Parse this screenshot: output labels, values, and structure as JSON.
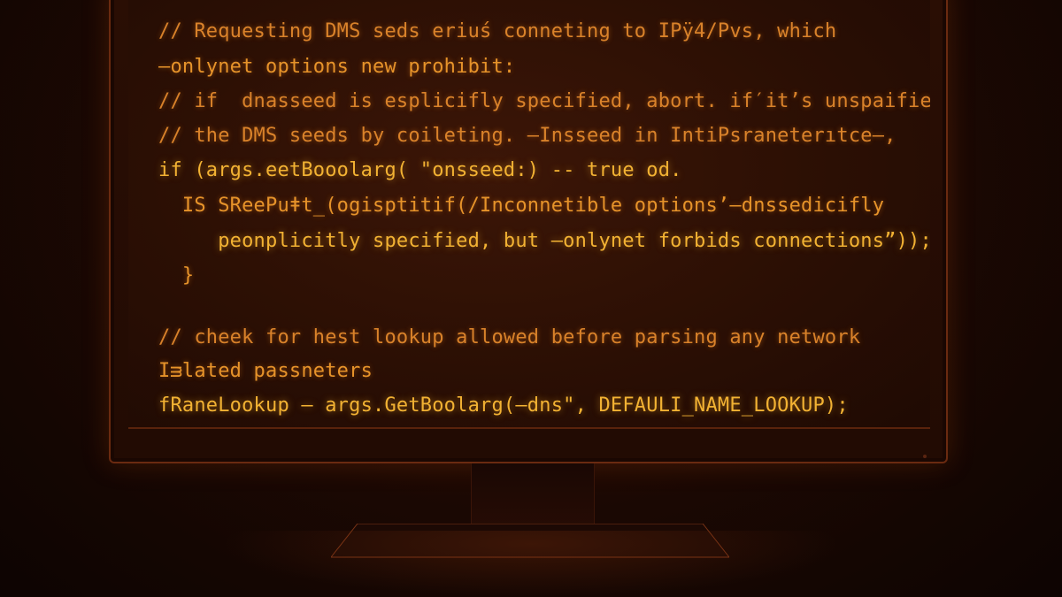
{
  "editor": {
    "lines": [
      "// Requesting DMS seds eriuś conneting to IPӱ4/Pvs, which",
      "–onlynet options new prohibit:",
      "// if  dnasseed is esplicifly specified, abort. if′it’s unspaified",
      "// the DMS seeds by coileting. –Insseed in IntiPsraneterıtce–,",
      "if (args.еetBooolarg( \"onsseed:) -- true οd.",
      "  IS SReePuǂt_(ogisptitif(/Inconnetible optionsʼ–dnssedicifly",
      "     peonplicitly specified, but –onlynet forbids connections”));",
      "  }",
      "",
      "// cheek for hest lookup allowed before parsing any network",
      "Iᴟlated passneters",
      "fRaneLookup – args.GetBoolarg(–dns\", DEFAULI_NAME_LOOKUP);"
    ]
  },
  "colors": {
    "code_text": "#e6932a",
    "background": "#1e0903",
    "monitor_frame": "#6a2a10"
  }
}
